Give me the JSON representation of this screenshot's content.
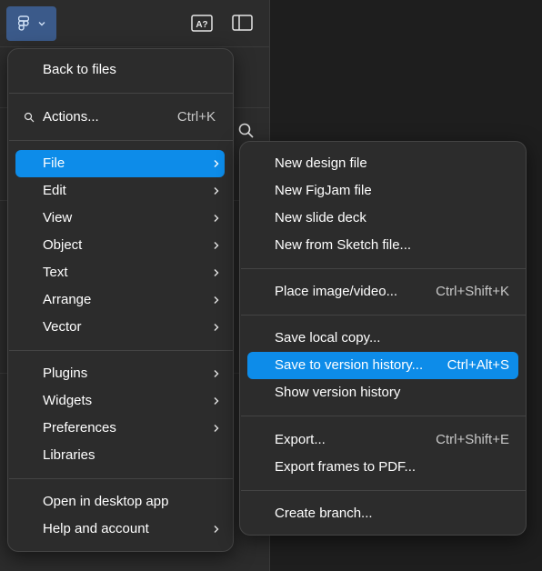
{
  "toolbar": {
    "logo_icon": "figma-icon",
    "dropdown_icon": "chevron-down-icon",
    "accessibility_icon": "text-check-icon",
    "accessibility_label": "A?",
    "sidebar_icon": "sidebar-toggle-icon",
    "search_icon": "search-icon"
  },
  "main_menu": {
    "back": "Back to files",
    "actions": {
      "label": "Actions...",
      "shortcut": "Ctrl+K"
    },
    "file": "File",
    "edit": "Edit",
    "view": "View",
    "object": "Object",
    "text": "Text",
    "arrange": "Arrange",
    "vector": "Vector",
    "plugins": "Plugins",
    "widgets": "Widgets",
    "preferences": "Preferences",
    "libraries": "Libraries",
    "open_desktop": "Open in desktop app",
    "help": "Help and account"
  },
  "file_menu": {
    "new_design": "New design file",
    "new_figjam": "New FigJam file",
    "new_slide": "New slide deck",
    "new_sketch": "New from Sketch file...",
    "place_image": {
      "label": "Place image/video...",
      "shortcut": "Ctrl+Shift+K"
    },
    "save_local": "Save local copy...",
    "save_version": {
      "label": "Save to version history...",
      "shortcut": "Ctrl+Alt+S"
    },
    "show_version": "Show version history",
    "export": {
      "label": "Export...",
      "shortcut": "Ctrl+Shift+E"
    },
    "export_pdf": "Export frames to PDF...",
    "create_branch": "Create branch..."
  },
  "colors": {
    "accent": "#0d8ce9",
    "menu_bg": "#2c2c2c",
    "canvas_bg": "#1e1e1e",
    "logo_button_bg": "#3b5a8a"
  }
}
